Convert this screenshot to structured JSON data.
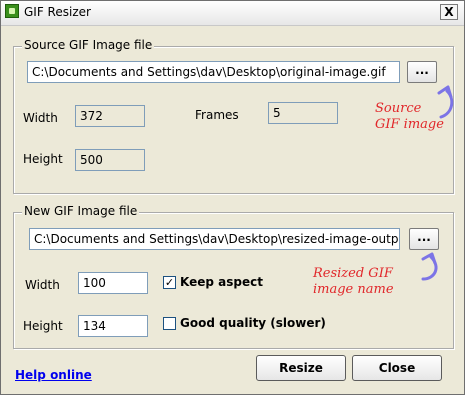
{
  "window": {
    "title": "GIF Resizer",
    "close_symbol": "X"
  },
  "source_group": {
    "legend": "Source GIF Image file",
    "path_value": "C:\\Documents and Settings\\dav\\Desktop\\original-image.gif",
    "browse_label": "...",
    "width_label": "Width",
    "width_value": "372",
    "height_label": "Height",
    "height_value": "500",
    "frames_label": "Frames",
    "frames_value": "5",
    "annotation": "Source\nGIF image"
  },
  "output_group": {
    "legend": "New GIF Image file",
    "path_value": "C:\\Documents and Settings\\dav\\Desktop\\resized-image-output.gi",
    "browse_label": "...",
    "width_label": "Width",
    "width_value": "100",
    "height_label": "Height",
    "height_value": "134",
    "keep_aspect_label": "Keep aspect",
    "keep_aspect_checked": true,
    "good_quality_label": "Good quality (slower)",
    "good_quality_checked": false,
    "annotation": "Resized GIF\nimage name"
  },
  "footer": {
    "help_link": "Help online",
    "resize_button": "Resize",
    "close_button": "Close"
  },
  "icons": {
    "app": "gif-resizer-app-icon",
    "check_mark": "✓"
  },
  "colors": {
    "annotation": "#e1272a",
    "arrow": "#7c74e6"
  }
}
